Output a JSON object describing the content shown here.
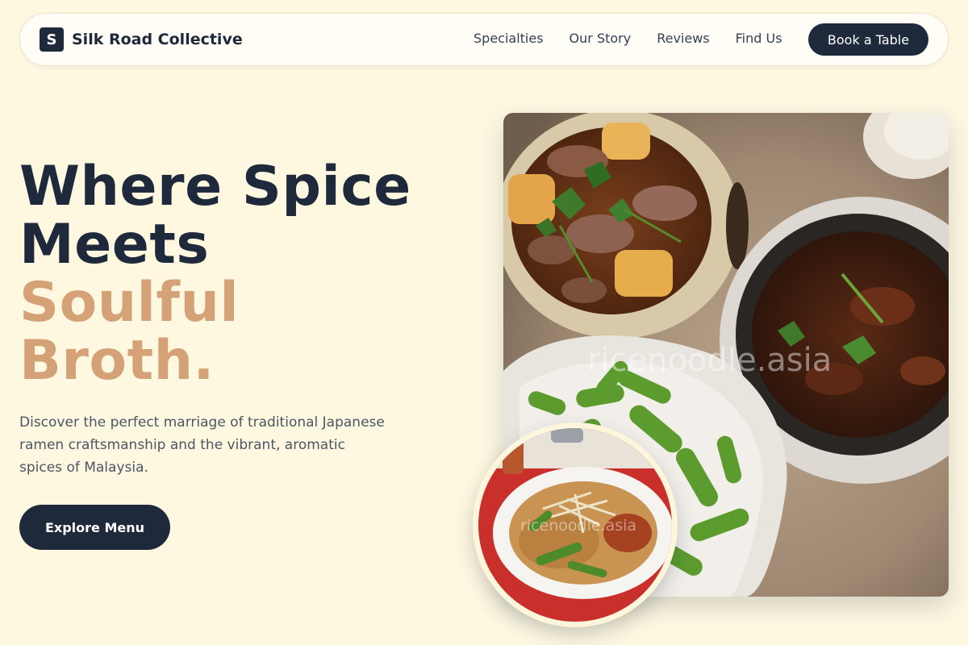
{
  "brand": {
    "logo_letter": "S",
    "name": "Silk Road Collective"
  },
  "nav": {
    "links": [
      "Specialties",
      "Our Story",
      "Reviews",
      "Find Us"
    ],
    "cta": "Book a Table"
  },
  "hero": {
    "headline_line1": "Where Spice",
    "headline_line2": "Meets",
    "headline_accent_line1": "Soulful",
    "headline_accent_line2": "Broth.",
    "tagline": "Discover the perfect marriage of traditional Japanese ramen craftsmanship and the vibrant, aromatic spices of Malaysia.",
    "cta": "Explore Menu"
  },
  "images": {
    "main_watermark": "ricenoodle.asia",
    "dish_watermark": "ricenoodle.asia"
  },
  "colors": {
    "background": "#fef8e1",
    "primary": "#1e293b",
    "accent": "#d4a276",
    "body_text": "#4b5563"
  }
}
